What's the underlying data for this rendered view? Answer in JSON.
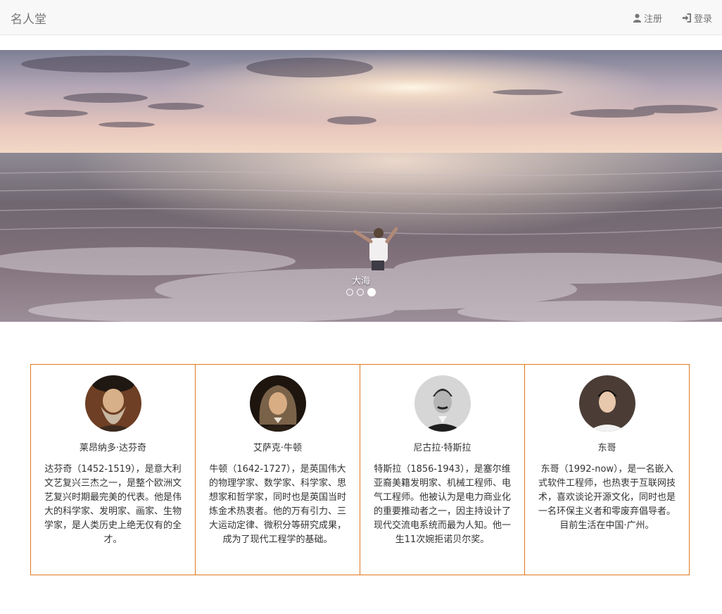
{
  "navbar": {
    "brand": "名人堂",
    "register_label": "注册",
    "register_icon": "user-icon",
    "login_label": "登录",
    "login_icon": "log-in-icon"
  },
  "carousel": {
    "caption": "大海",
    "slide_count": 3,
    "active_index": 2
  },
  "people": [
    {
      "name": "莱昂纳多·达芬奇",
      "description": "达芬奇（1452-1519），是意大利文艺复兴三杰之一，是整个欧洲文艺复兴时期最完美的代表。他是伟大的科学家、发明家、画家、生物学家，是人类历史上绝无仅有的全才。"
    },
    {
      "name": "艾萨克·牛顿",
      "description": "牛顿（1642-1727），是英国伟大的物理学家、数学家、科学家、思想家和哲学家，同时也是英国当时炼金术热衷者。他的万有引力、三大运动定律、微积分等研究成果，成为了现代工程学的基础。"
    },
    {
      "name": "尼古拉·特斯拉",
      "description": "特斯拉（1856-1943），是塞尔维亚裔美籍发明家、机械工程师、电气工程师。他被认为是电力商业化的重要推动者之一，因主持设计了现代交流电系统而最为人知。他一生11次婉拒诺贝尔奖。"
    },
    {
      "name": "东哥",
      "description": "东哥（1992-now），是一名嵌入式软件工程师，也热衷于互联网技术，喜欢谈论开源文化，同时也是一名环保主义者和零废弃倡导者。目前生活在中国·广州。"
    }
  ],
  "colors": {
    "card_border": "#e07a1f",
    "navbar_bg": "#f8f8f8"
  }
}
